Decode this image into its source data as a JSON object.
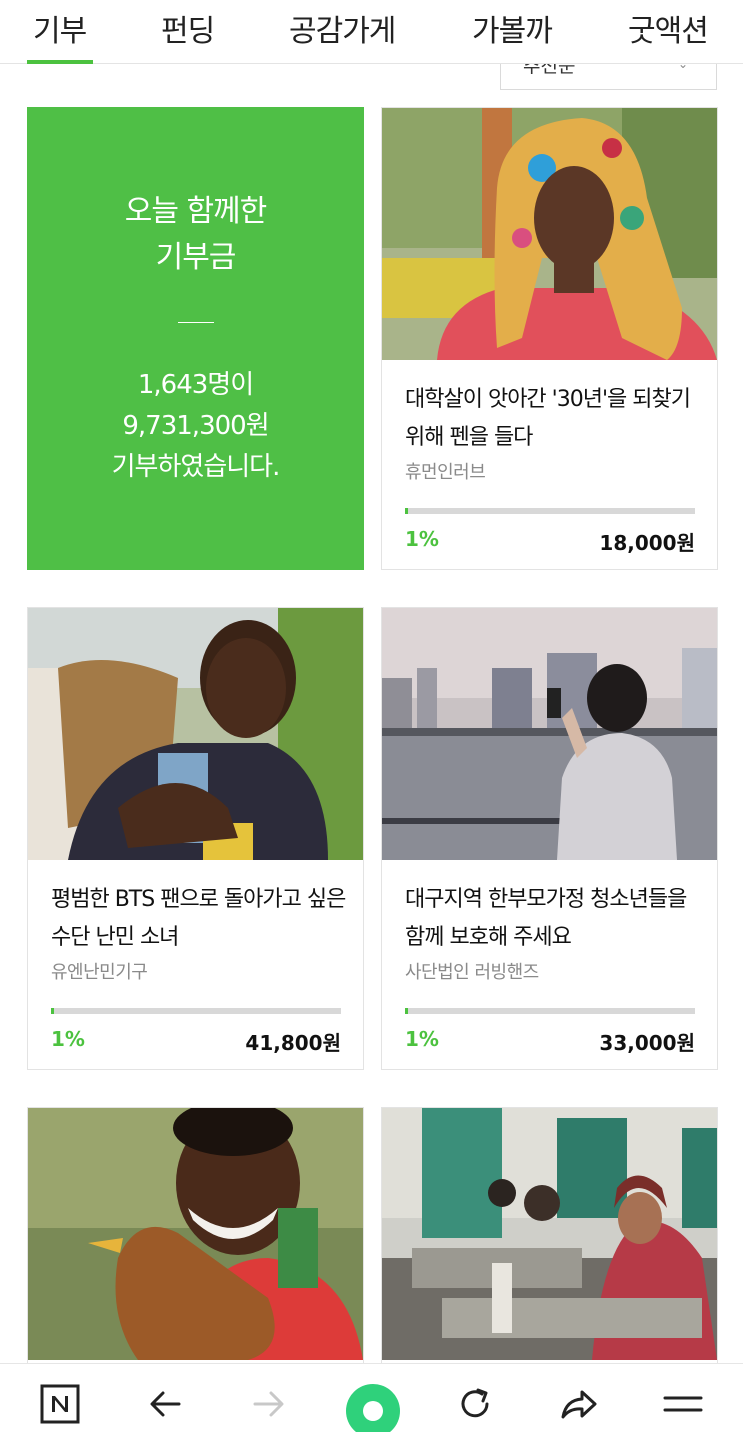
{
  "tabs": [
    {
      "label": "기부",
      "active": true
    },
    {
      "label": "펀딩",
      "active": false
    },
    {
      "label": "공감가게",
      "active": false
    },
    {
      "label": "가볼까",
      "active": false
    },
    {
      "label": "굿액션",
      "active": false
    }
  ],
  "sort": {
    "selected": "추천순",
    "icon": "chevron-down-icon"
  },
  "summary": {
    "title_line1": "오늘 함께한",
    "title_line2": "기부금",
    "count_text": "1,643명이",
    "amount_text": "9,731,300원",
    "suffix_text": "기부하였습니다.",
    "color": "#4fbf46"
  },
  "campaigns": [
    {
      "title": "대학살이 앗아간 '30년'을 되찾기 위해 펜을 들다",
      "org": "휴먼인러브",
      "progress_percent": 1,
      "percent_label": "1%",
      "amount": "18,000원"
    },
    {
      "title": "평범한 BTS 팬으로 돌아가고 싶은 수단 난민 소녀",
      "org": "유엔난민기구",
      "progress_percent": 1,
      "percent_label": "1%",
      "amount": "41,800원"
    },
    {
      "title": "대구지역 한부모가정 청소년들을 함께 보호해 주세요",
      "org": "사단법인 러빙핸즈",
      "progress_percent": 1,
      "percent_label": "1%",
      "amount": "33,000원"
    },
    {
      "title": "",
      "org": "",
      "percent_label": "",
      "amount": ""
    },
    {
      "title": "",
      "org": "",
      "percent_label": "",
      "amount": ""
    }
  ],
  "bottom_bar": {
    "icons": [
      "naver-n-icon",
      "back-arrow-icon",
      "forward-arrow-icon",
      "home-circle-icon",
      "refresh-icon",
      "share-icon",
      "menu-icon"
    ],
    "accent": "#2fd17b"
  },
  "accent_color": "#4cc23f"
}
